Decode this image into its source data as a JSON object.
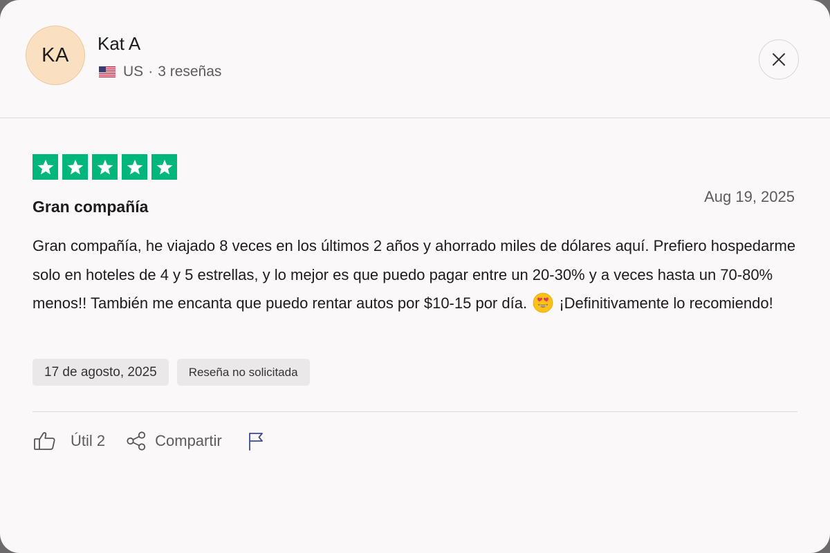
{
  "reviewer": {
    "initials": "KA",
    "name": "Kat A",
    "country": "US",
    "separator": "·",
    "review_count": "3 reseñas",
    "flag_icon": "us-flag-icon"
  },
  "close_icon": "close-icon",
  "review": {
    "rating": 5,
    "rating_max": 5,
    "star_color": "#00b67a",
    "date": "Aug 19, 2025",
    "title": "Gran compañía",
    "body_text": "Gran compañía, he viajado 8 veces en los últimos 2 años y ahorrado miles de dólares aquí. Prefiero hospedarme solo en hoteles de 4 y 5 estrellas, y lo mejor es que puedo pagar entre un 20-30% y a veces hasta un 70-80% menos!! También me encanta que puedo rentar autos por $10-15 por día.",
    "body_emoji": "heart-eyes-emoji",
    "body_text_end": "¡Definitivamente lo recomiendo!",
    "experience_date": "17 de agosto, 2025",
    "status_tag": "Reseña no solicitada"
  },
  "actions": {
    "helpful_label": "Útil 2",
    "share_label": "Compartir",
    "helpful_icon": "thumbs-up-icon",
    "share_icon": "share-icon",
    "report_icon": "flag-icon"
  }
}
